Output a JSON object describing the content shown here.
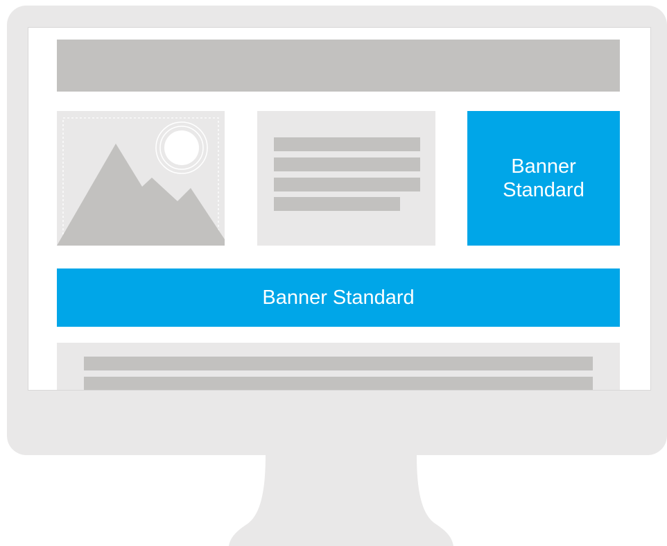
{
  "colors": {
    "frame": "#e9e8e8",
    "placeholder": "#c2c1bf",
    "accent": "#00a6e8",
    "screen": "#ffffff"
  },
  "icons": {
    "image_placeholder": "mountain-sun-image-icon"
  },
  "banners": {
    "square_label": "Banner\nStandard",
    "wide_label": "Banner Standard"
  }
}
